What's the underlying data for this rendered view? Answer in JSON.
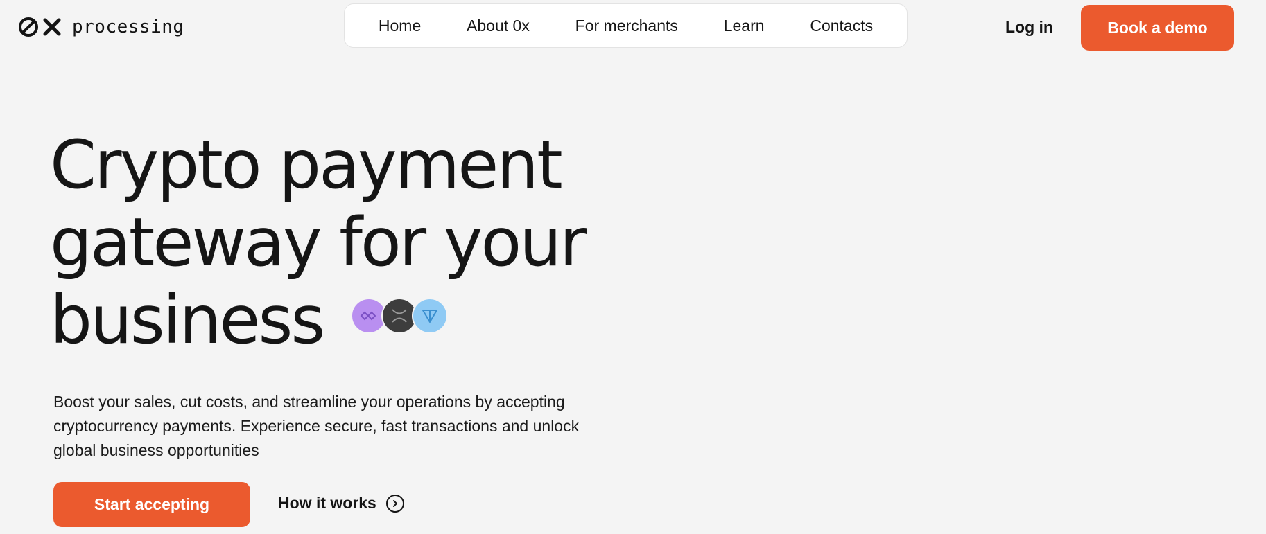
{
  "brand": {
    "logo_icons": [
      "zero-slash-icon",
      "x-icon"
    ],
    "name": "processing"
  },
  "nav": {
    "items": [
      {
        "label": "Home"
      },
      {
        "label": "About 0x"
      },
      {
        "label": "For merchants"
      },
      {
        "label": "Learn"
      },
      {
        "label": "Contacts"
      }
    ]
  },
  "header": {
    "login_label": "Log in",
    "demo_label": "Book a demo"
  },
  "hero": {
    "title_lines": [
      "Crypto payment",
      "gateway for your",
      "business"
    ],
    "coins": [
      "polygon-icon",
      "xrp-icon",
      "ton-icon"
    ],
    "description": "Boost your sales, cut costs, and streamline your operations by accepting cryptocurrency payments. Experience secure, fast transactions and unlock global business opportunities",
    "primary_cta": "Start accepting",
    "secondary_cta": "How it works",
    "secondary_cta_icon": "chevron-right-circle-icon"
  },
  "colors": {
    "accent": "#eb5a2e",
    "background": "#f4f4f4",
    "text": "#151515"
  }
}
